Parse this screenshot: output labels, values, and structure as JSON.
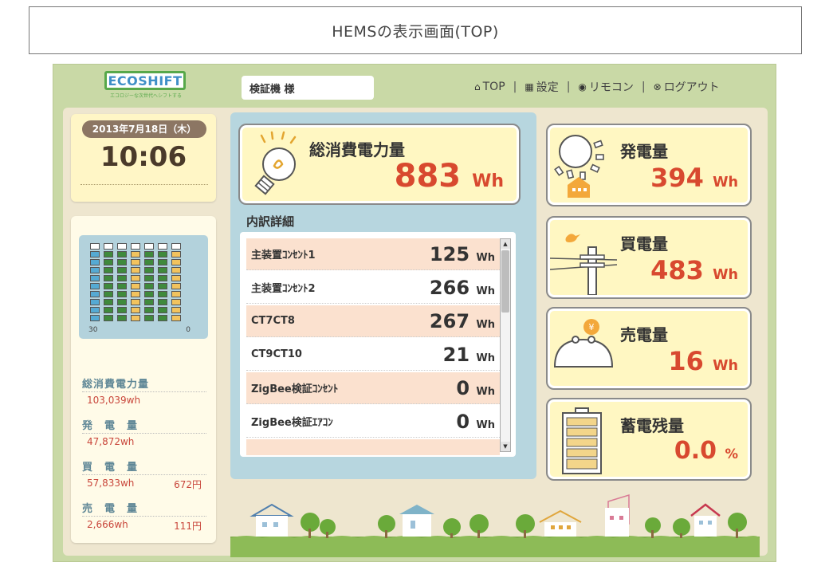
{
  "page_title": "HEMSの表示画面(TOP)",
  "header": {
    "logo_text": "ECOSHIFT",
    "logo_tagline": "エコロジーな次世代へシフトする",
    "user_name": "検証機 様",
    "nav": [
      {
        "label": "TOP",
        "icon": "home-icon"
      },
      {
        "label": "設定",
        "icon": "grid-icon"
      },
      {
        "label": "リモコン",
        "icon": "remote-icon"
      },
      {
        "label": "ログアウト",
        "icon": "close-circle-icon"
      }
    ]
  },
  "datetime": {
    "date": "2013年7月18日（木）",
    "time": "10:06"
  },
  "meter": {
    "label_left": "30",
    "label_right": "0",
    "columns": [
      "blue",
      "green",
      "green",
      "yellow",
      "green",
      "green",
      "yellow"
    ],
    "colors": {
      "blue": "#55aad3",
      "green": "#3f8a3c",
      "yellow": "#f2c35e",
      "empty": "#ffffff"
    }
  },
  "left_stats": [
    {
      "label": "総消費電力量",
      "value": "103,039wh",
      "yen": ""
    },
    {
      "label": "発　電　量",
      "value": "47,872wh",
      "yen": ""
    },
    {
      "label": "買　電　量",
      "value": "57,833wh",
      "yen": "672円"
    },
    {
      "label": "売　電　量",
      "value": "2,666wh",
      "yen": "111円"
    }
  ],
  "total": {
    "title": "総消費電力量",
    "value": "883",
    "unit": "Wh"
  },
  "breakdown": {
    "title": "内訳詳細",
    "rows": [
      {
        "name": "主装置ｺﾝｾﾝﾄ1",
        "value": "125",
        "unit": "Wh"
      },
      {
        "name": "主装置ｺﾝｾﾝﾄ2",
        "value": "266",
        "unit": "Wh"
      },
      {
        "name": "CT7CT8",
        "value": "267",
        "unit": "Wh"
      },
      {
        "name": "CT9CT10",
        "value": "21",
        "unit": "Wh"
      },
      {
        "name": "ZigBee検証ｺﾝｾﾝﾄ",
        "value": "0",
        "unit": "Wh"
      },
      {
        "name": "ZigBee検証ｴｱｺﾝ",
        "value": "0",
        "unit": "Wh"
      }
    ]
  },
  "right_cards": [
    {
      "title": "発電量",
      "value": "394",
      "unit": "Wh",
      "icon": "sun-house-icon"
    },
    {
      "title": "買電量",
      "value": "483",
      "unit": "Wh",
      "icon": "power-pole-bird-icon"
    },
    {
      "title": "売電量",
      "value": "16",
      "unit": "Wh",
      "icon": "coin-purse-icon"
    },
    {
      "title": "蓄電残量",
      "value": "0.0",
      "unit": "%",
      "icon": "battery-icon"
    }
  ],
  "colors": {
    "accent_red": "#d8492f",
    "frame_green": "#c9d9a6",
    "panel_blue": "#b7d6df",
    "card_yellow": "#fff7c2",
    "row_pink": "#fbe1cf"
  }
}
